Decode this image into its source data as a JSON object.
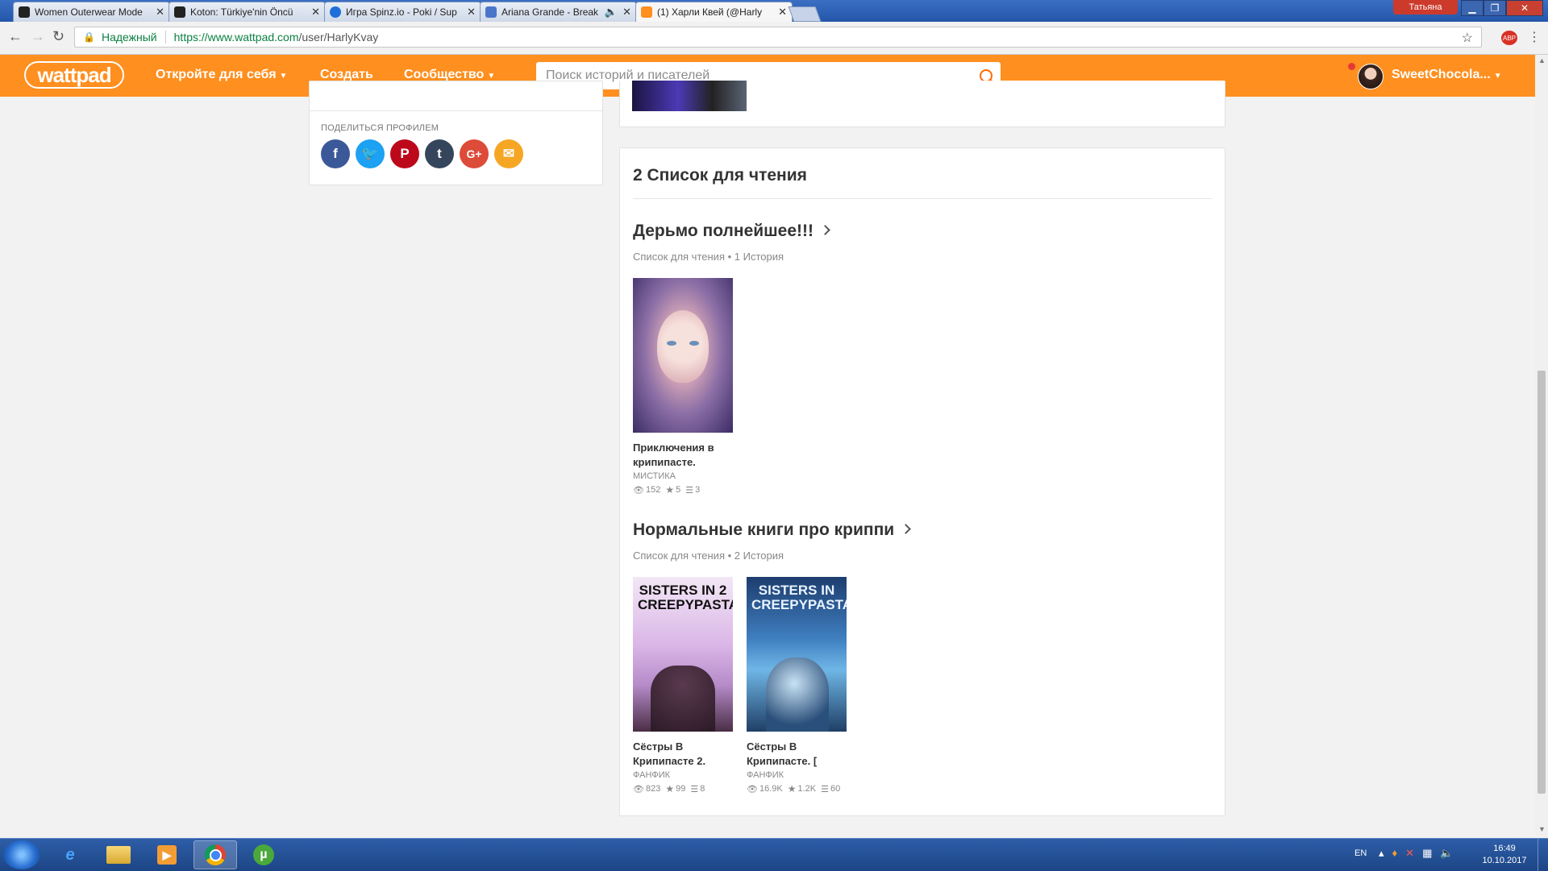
{
  "browser": {
    "tabs": [
      {
        "title": "Women Outerwear Mode",
        "favicon_color": "#222222"
      },
      {
        "title": "Koton: Türkiye'nin Öncü",
        "favicon_color": "#222222"
      },
      {
        "title": "Игра Spinz.io - Poki / Sup",
        "favicon_color": "#1e6fd9"
      },
      {
        "title": "Ariana Grande - Break",
        "favicon_color": "#4a76c9"
      },
      {
        "title": "(1) Харли Квей (@Harly",
        "favicon_color": "#ff8f1f"
      }
    ],
    "window_user": "Татьяна",
    "secure_label": "Надежный",
    "url_host": "https://www.wattpad.com",
    "url_path": "/user/HarlyKvay"
  },
  "header": {
    "logo": "wattpad",
    "nav": {
      "discover": "Откройте для себя",
      "create": "Создать",
      "community": "Сообщество"
    },
    "search_placeholder": "Поиск историй и писателей",
    "username": "SweetChocola...",
    "brand_color": "#ff8f1f"
  },
  "share": {
    "label": "ПОДЕЛИТЬСЯ ПРОФИЛЕМ",
    "buttons": [
      {
        "name": "facebook",
        "glyph": "f",
        "color": "#3b5998"
      },
      {
        "name": "twitter",
        "glyph": "t",
        "color": "#1da1f2"
      },
      {
        "name": "pinterest",
        "glyph": "p",
        "color": "#bd081c"
      },
      {
        "name": "tumblr",
        "glyph": "t",
        "color": "#35465c"
      },
      {
        "name": "google-plus",
        "glyph": "G+",
        "color": "#dd4b39"
      },
      {
        "name": "email",
        "glyph": "✉",
        "color": "#f5a623"
      }
    ]
  },
  "reading_lists": {
    "heading": "2 Список для чтения",
    "lists": [
      {
        "title": "Дерьмо полнейшее!!!",
        "meta": "Список для чтения • 1 История",
        "books": [
          {
            "title_line1": "Приключения в",
            "title_line2": "крипипасте.",
            "genre": "МИСТИКА",
            "views": "152",
            "votes": "5",
            "parts": "3",
            "cover_text": ""
          }
        ]
      },
      {
        "title": "Нормальные книги про криппи",
        "meta": "Список для чтения • 2 История",
        "books": [
          {
            "title_line1": "Сёстры В",
            "title_line2": "Крипипасте 2.",
            "genre": "ФАНФИК",
            "views": "823",
            "votes": "99",
            "parts": "8",
            "cover_text": "SISTERS IN 2 CREEPYPASTA"
          },
          {
            "title_line1": "Сёстры В",
            "title_line2": "Крипипасте. [",
            "genre": "ФАНФИК",
            "views": "16.9K",
            "votes": "1.2K",
            "parts": "60",
            "cover_text": "SISTERS IN CREEPYPASTA"
          }
        ]
      }
    ]
  },
  "taskbar": {
    "lang": "EN",
    "time": "16:49",
    "date": "10.10.2017"
  }
}
